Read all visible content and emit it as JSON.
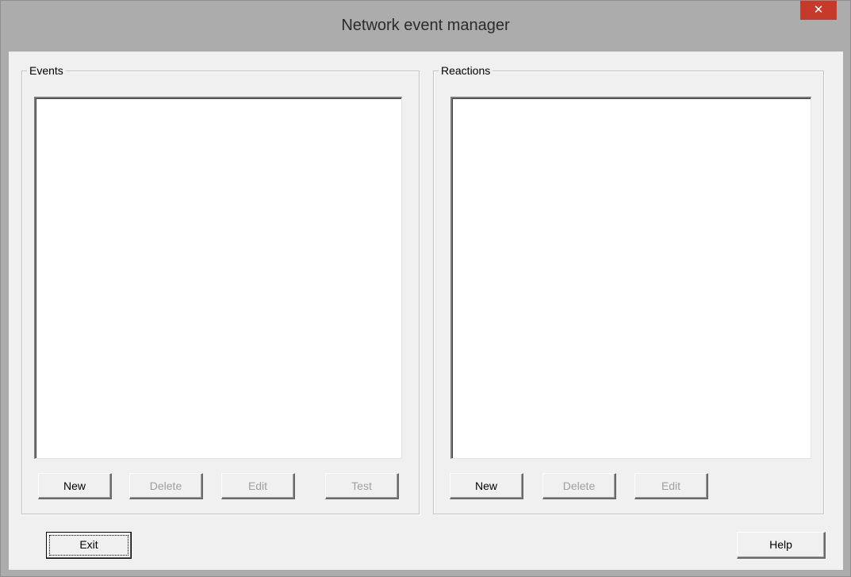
{
  "window": {
    "title": "Network event manager",
    "close_symbol": "✕"
  },
  "events": {
    "group_label": "Events",
    "items": [],
    "buttons": {
      "new": "New",
      "delete": "Delete",
      "edit": "Edit",
      "test": "Test"
    }
  },
  "reactions": {
    "group_label": "Reactions",
    "items": [],
    "buttons": {
      "new": "New",
      "delete": "Delete",
      "edit": "Edit"
    }
  },
  "footer": {
    "exit_label": "Exit",
    "help_label": "Help"
  },
  "colors": {
    "titlebar": "#acacac",
    "client_bg": "#f0f0f0",
    "close_button": "#c7392b",
    "disabled_text": "#a0a0a0"
  },
  "icons": {
    "close": "close-icon"
  }
}
